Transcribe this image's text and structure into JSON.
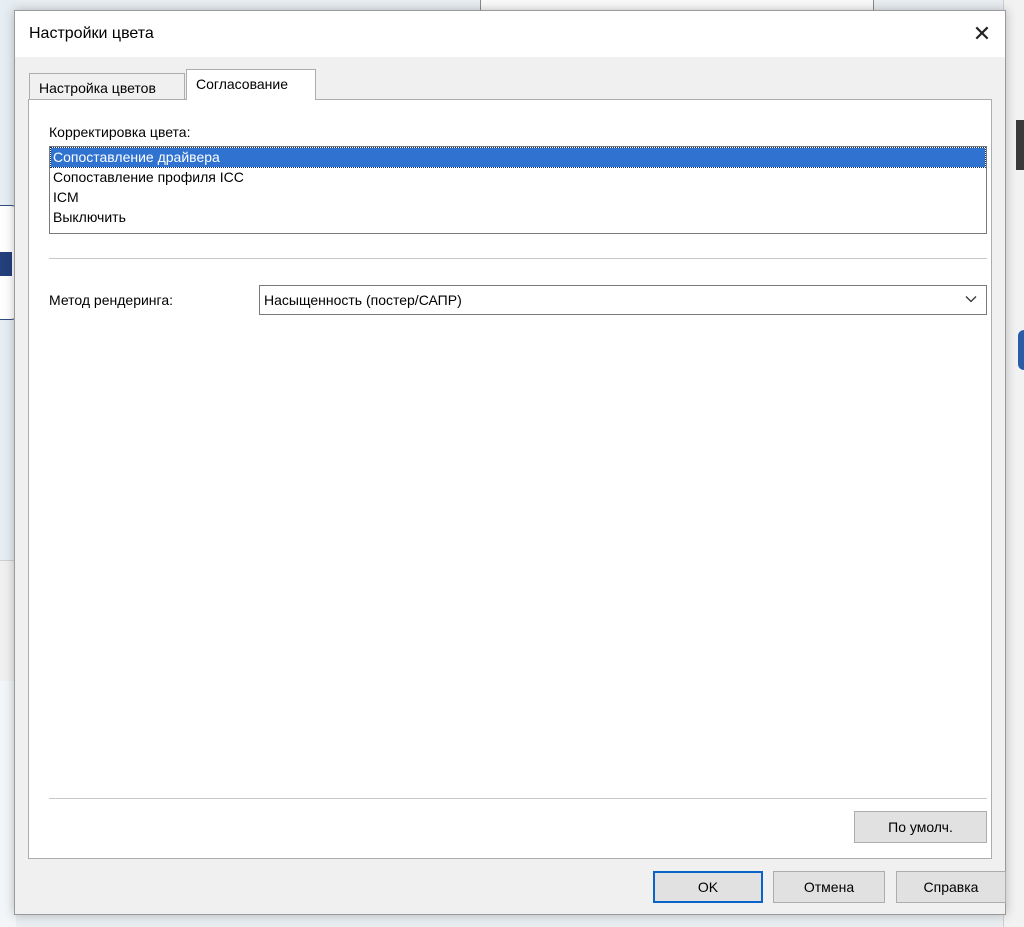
{
  "dialog": {
    "title": "Настройки цвета",
    "close_glyph": "✕"
  },
  "tabs": [
    {
      "label": "Настройка цветов",
      "active": false
    },
    {
      "label": "Согласование",
      "active": true
    }
  ],
  "correction": {
    "label": "Корректировка цвета:",
    "items": [
      {
        "label": "Сопоставление драйвера",
        "selected": true
      },
      {
        "label": "Сопоставление профиля ICC",
        "selected": false
      },
      {
        "label": "ICM",
        "selected": false
      },
      {
        "label": "Выключить",
        "selected": false
      }
    ]
  },
  "rendering": {
    "label": "Метод рендеринга:",
    "selected_value": "Насыщенность (постер/САПР)"
  },
  "buttons": {
    "defaults": "По умолч.",
    "ok": "OK",
    "cancel": "Отмена",
    "help": "Справка"
  },
  "colors": {
    "selection": "#2f72d0",
    "ok_border": "#0a64c8"
  }
}
